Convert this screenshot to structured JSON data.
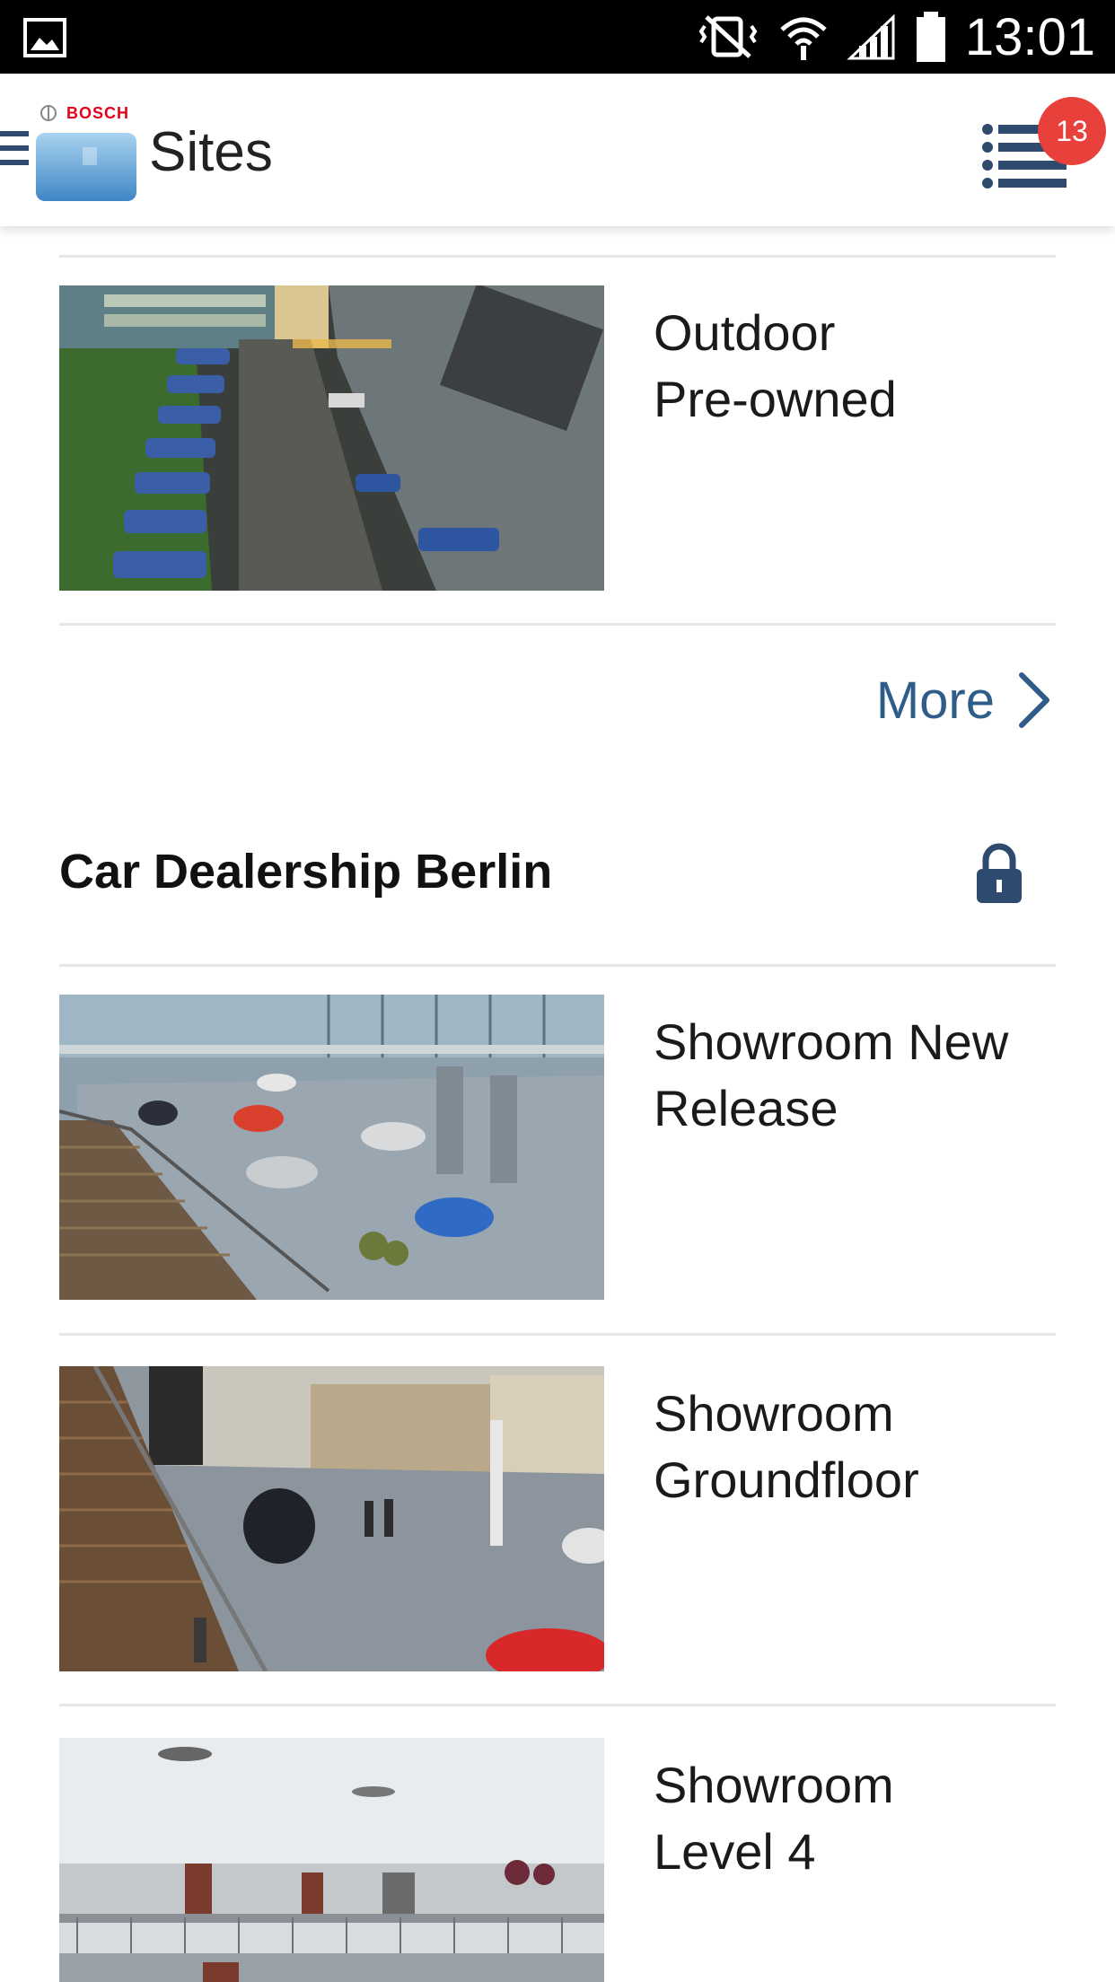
{
  "status_bar": {
    "time": "13:01",
    "icons": [
      "gallery-notification-icon",
      "vibrate-mute-icon",
      "wifi-icon",
      "cell-signal-icon",
      "battery-icon"
    ]
  },
  "app_bar": {
    "logo_text": "BOSCH",
    "title": "Sites",
    "events_badge": "13"
  },
  "colors": {
    "link": "#2f5d8a",
    "badge": "#e8403a",
    "lock": "#2e4a6e"
  },
  "sites": [
    {
      "cameras": [
        {
          "name_line1": "Outdoor",
          "name_line2": "Pre-owned"
        }
      ],
      "more_label": "More"
    },
    {
      "name": "Car Dealership Berlin",
      "locked": true,
      "cameras": [
        {
          "name_line1": "Showroom New",
          "name_line2": "Release"
        },
        {
          "name_line1": "Showroom",
          "name_line2": "Groundfloor"
        },
        {
          "name_line1": "Showroom",
          "name_line2": "Level 4"
        }
      ]
    }
  ]
}
